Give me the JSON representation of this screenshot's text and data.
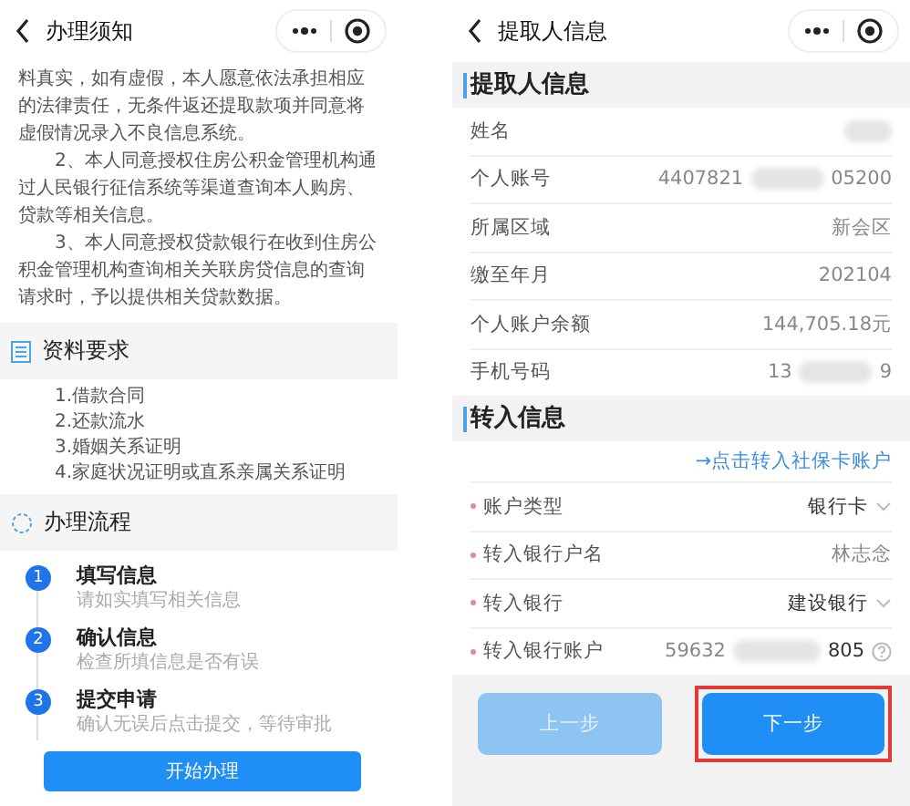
{
  "left_screen": {
    "title": "办理须知",
    "paragraphs": [
      "料真实，如有虚假，本人愿意依法承担相应的法律责任，无条件返还提取款项并同意将虚假情况录入不良信息系统。",
      "2、本人同意授权住房公积金管理机构通过人民银行征信系统等渠道查询本人购房、贷款等相关信息。",
      "3、本人同意授权贷款银行在收到住房公积金管理机构查询相关关联房贷信息的查询请求时，予以提供相关贷款数据。"
    ],
    "materials": {
      "title": "资料要求",
      "items": [
        "1.借款合同",
        "2.还款流水",
        "3.婚姻关系证明",
        "4.家庭状况证明或直系亲属关系证明"
      ]
    },
    "process": {
      "title": "办理流程",
      "steps": [
        {
          "number": "1",
          "title": "填写信息",
          "desc": "请如实填写相关信息"
        },
        {
          "number": "2",
          "title": "确认信息",
          "desc": "检查所填信息是否有误"
        },
        {
          "number": "3",
          "title": "提交申请",
          "desc": "确认无误后点击提交，等待审批"
        }
      ]
    },
    "start_button": "开始办理"
  },
  "right_screen": {
    "title": "提取人信息",
    "applicant": {
      "title": "提取人信息",
      "rows": [
        {
          "label": "姓名",
          "kind": "masked"
        },
        {
          "label": "个人账号",
          "kind": "partly_masked",
          "value": "4407821",
          "value_end": "05200"
        },
        {
          "label": "所属区域",
          "kind": "text",
          "value": "新会区"
        },
        {
          "label": "缴至年月",
          "kind": "text",
          "value": "202104"
        },
        {
          "label": "个人账户余额",
          "kind": "text",
          "value": "144,705.18元"
        },
        {
          "label": "手机号码",
          "kind": "partly_masked",
          "value": "13",
          "value_end": "9"
        }
      ]
    },
    "transfer": {
      "title": "转入信息",
      "link": "→点击转入社保卡账户",
      "rows": [
        {
          "label": "账户类型",
          "kind": "select",
          "value": "银行卡"
        },
        {
          "label": "转入银行户名",
          "kind": "text",
          "value": "林志念"
        },
        {
          "label": "转入银行",
          "kind": "select",
          "value": "建设银行"
        },
        {
          "label": "转入银行账户",
          "kind": "help",
          "value": "59632",
          "value_end": "805"
        }
      ]
    },
    "buttons": [
      {
        "label": "上一步",
        "disabled": true,
        "highlighted": false
      },
      {
        "label": "下一步",
        "disabled": false,
        "highlighted": true
      }
    ]
  }
}
